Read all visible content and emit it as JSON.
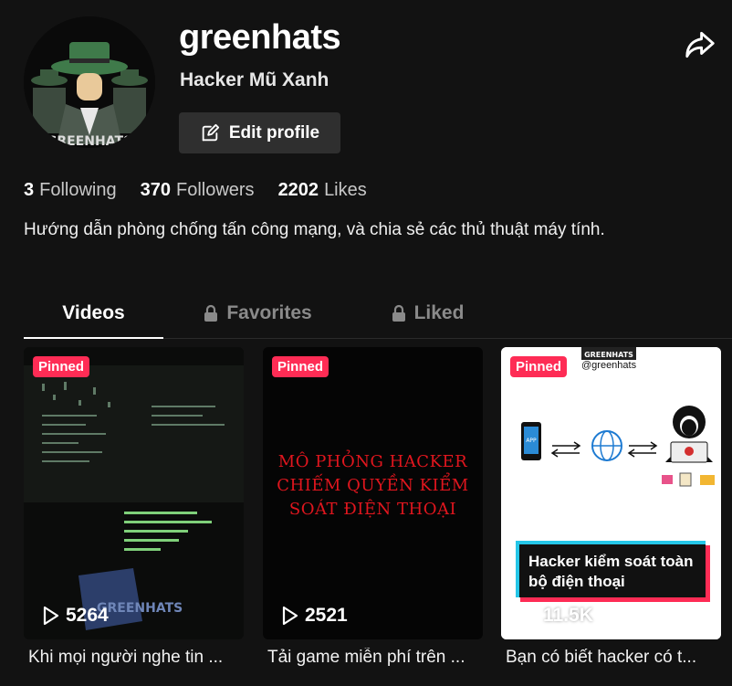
{
  "profile": {
    "username": "greenhats",
    "nickname": "Hacker Mũ Xanh",
    "avatar_text": "GREENHATS",
    "edit_label": "Edit profile",
    "bio": "Hướng dẫn phòng chống tấn công mạng, và chia sẻ các thủ thuật máy tính."
  },
  "stats": [
    {
      "value": "3",
      "label": "Following"
    },
    {
      "value": "370",
      "label": "Followers"
    },
    {
      "value": "2202",
      "label": "Likes"
    }
  ],
  "tabs": [
    {
      "label": "Videos",
      "active": true,
      "locked": false
    },
    {
      "label": "Favorites",
      "active": false,
      "locked": true
    },
    {
      "label": "Liked",
      "active": false,
      "locked": true
    }
  ],
  "videos": [
    {
      "pinned_label": "Pinned",
      "views": "5264",
      "caption": "Khi mọi người nghe tin ...",
      "thumb_text": "GREENHATS"
    },
    {
      "pinned_label": "Pinned",
      "views": "2521",
      "caption": "Tải game miễn phí trên ...",
      "thumb_text": "MÔ PHỎNG HACKER\nCHIẾM QUYỀN KIỂM\nSOÁT ĐIỆN THOẠI"
    },
    {
      "pinned_label": "Pinned",
      "views": "11.5K",
      "caption": "Bạn có biết hacker có t...",
      "thumb_handle": "@greenhats",
      "thumb_brand": "GREENHATS",
      "thumb_app": "APP",
      "thumb_title": "Hacker kiểm soát toàn bộ điện thoại"
    }
  ],
  "colors": {
    "accent": "#fe2c55",
    "background": "#121212",
    "cyan": "#25c6e8"
  },
  "icons": [
    "share-icon",
    "edit-icon",
    "lock-icon",
    "play-icon"
  ]
}
